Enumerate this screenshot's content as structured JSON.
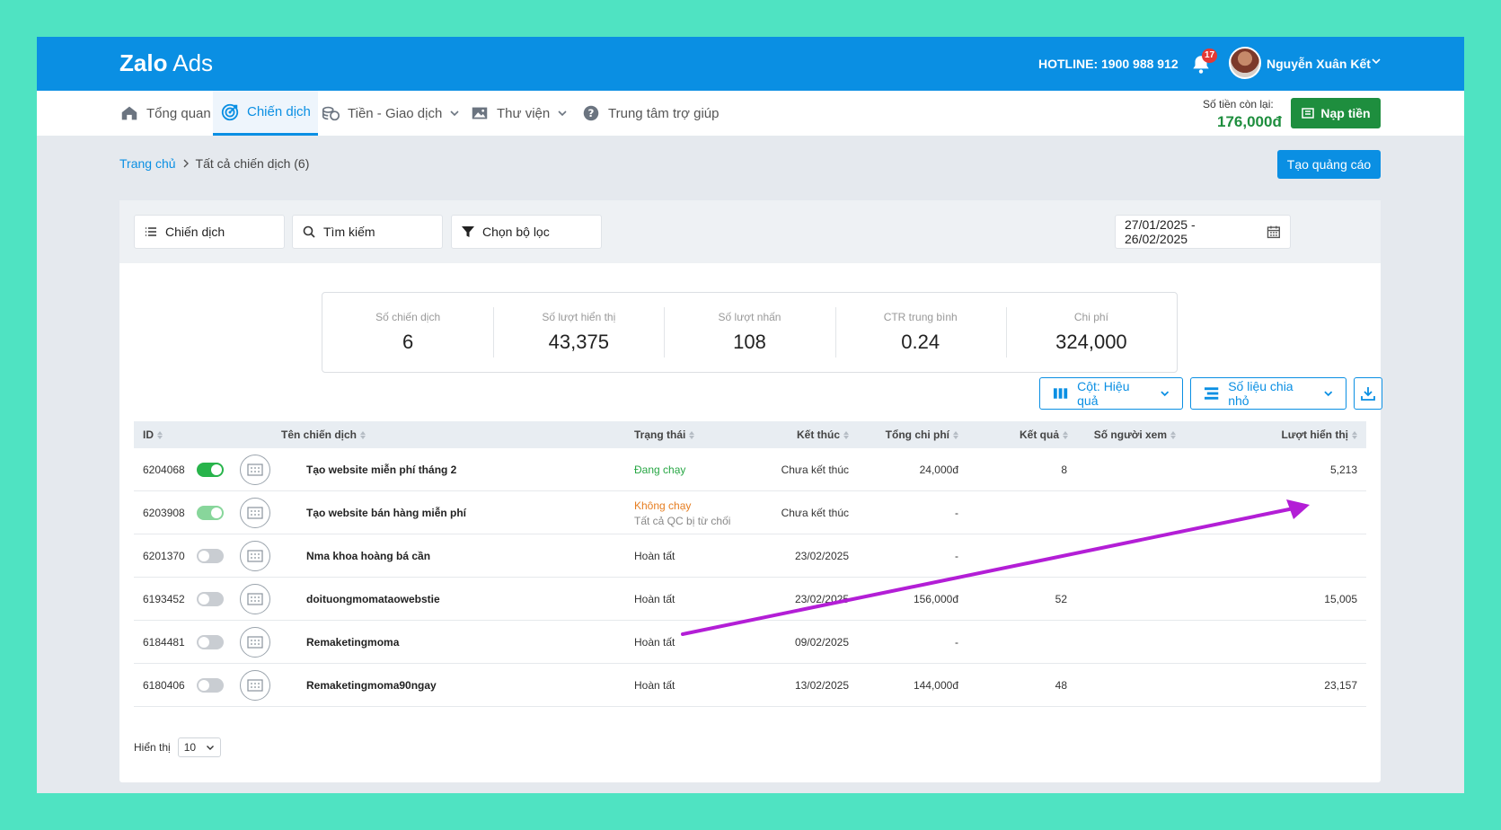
{
  "brand": {
    "logo_main": "Zalo",
    "logo_sub": "Ads"
  },
  "header": {
    "hotline": "HOTLINE: 1900 988 912",
    "notification_count": "17",
    "username": "Nguyễn Xuân Kết"
  },
  "nav": {
    "items": [
      {
        "label": "Tổng quan",
        "icon": "home-icon"
      },
      {
        "label": "Chiến dịch",
        "icon": "target-icon"
      },
      {
        "label": "Tiền - Giao dịch",
        "icon": "coins-icon"
      },
      {
        "label": "Thư viện",
        "icon": "image-icon"
      },
      {
        "label": "Trung tâm trợ giúp",
        "icon": "help-icon"
      }
    ],
    "active": "Chiến dịch"
  },
  "balance": {
    "label": "Số tiền còn lại:",
    "value": "176,000đ"
  },
  "topup_label": "Nạp tiền",
  "breadcrumb": {
    "home": "Trang chủ",
    "current": "Tất cả chiến dịch (6)"
  },
  "create_ad_label": "Tạo quảng cáo",
  "filters": {
    "campaign_select": "Chiến dịch",
    "search_placeholder": "Tìm kiếm",
    "filter_label": "Chọn bộ lọc",
    "date_range": "27/01/2025 - 26/02/2025"
  },
  "stats": [
    {
      "label": "Số chiến dịch",
      "value": "6"
    },
    {
      "label": "Số lượt hiển thị",
      "value": "43,375"
    },
    {
      "label": "Số lượt nhấn",
      "value": "108"
    },
    {
      "label": "CTR trung bình",
      "value": "0.24"
    },
    {
      "label": "Chi phí",
      "value": "324,000"
    }
  ],
  "tools": {
    "columns_label": "Cột: Hiệu quả",
    "breakdown_label": "Số liệu chia nhỏ"
  },
  "table": {
    "headers": {
      "id": "ID",
      "name": "Tên chiến dịch",
      "status": "Trạng thái",
      "end": "Kết thúc",
      "cost": "Tổng chi phí",
      "result": "Kết quả",
      "viewers": "Số người xem",
      "impressions": "Lượt hiển thị"
    },
    "rows": [
      {
        "id": "6204068",
        "toggle": "on",
        "name": "Tạo website miễn phí tháng 2",
        "status": "Đang chạy",
        "status_type": "running",
        "status_sub": "",
        "end": "Chưa kết thúc",
        "cost": "24,000đ",
        "result": "8",
        "viewers": "",
        "impressions": "5,213"
      },
      {
        "id": "6203908",
        "toggle": "on-light",
        "name": "Tạo website bán hàng miễn phí",
        "status": "Không chạy",
        "status_type": "stopped",
        "status_sub": "Tất cả QC bị từ chối",
        "end": "Chưa kết thúc",
        "cost": "-",
        "result": "",
        "viewers": "",
        "impressions": ""
      },
      {
        "id": "6201370",
        "toggle": "off",
        "name": "Nma khoa hoàng bá cần",
        "status": "Hoàn tất",
        "status_type": "done",
        "status_sub": "",
        "end": "23/02/2025",
        "cost": "-",
        "result": "",
        "viewers": "",
        "impressions": ""
      },
      {
        "id": "6193452",
        "toggle": "off",
        "name": "doituongmomataowebstie",
        "status": "Hoàn tất",
        "status_type": "done",
        "status_sub": "",
        "end": "23/02/2025",
        "cost": "156,000đ",
        "result": "52",
        "viewers": "",
        "impressions": "15,005"
      },
      {
        "id": "6184481",
        "toggle": "off",
        "name": "Remaketingmoma",
        "status": "Hoàn tất",
        "status_type": "done",
        "status_sub": "",
        "end": "09/02/2025",
        "cost": "-",
        "result": "",
        "viewers": "",
        "impressions": ""
      },
      {
        "id": "6180406",
        "toggle": "off",
        "name": "Remaketingmoma90ngay",
        "status": "Hoàn tất",
        "status_type": "done",
        "status_sub": "",
        "end": "13/02/2025",
        "cost": "144,000đ",
        "result": "48",
        "viewers": "",
        "impressions": "23,157"
      }
    ]
  },
  "pager": {
    "label": "Hiển thị",
    "page_size": "10"
  },
  "colors": {
    "brand_blue": "#0a8fe3",
    "green": "#1e8e3e",
    "annotation_arrow": "#b31ed6",
    "frame_bg": "#4fe3c2"
  }
}
